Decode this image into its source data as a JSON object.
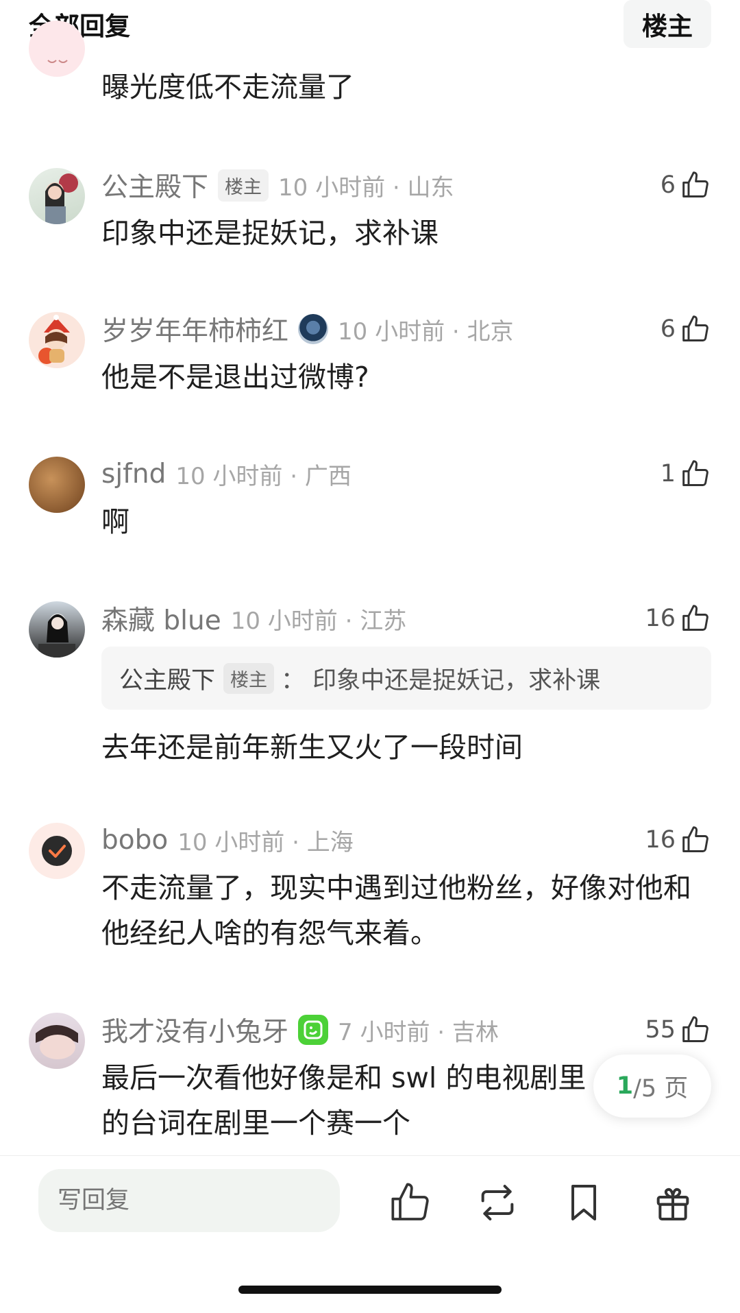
{
  "header": {
    "title": "全部回复",
    "owner_button": "楼主"
  },
  "comments": [
    {
      "author": "",
      "body": "曝光度低不走流量了"
    },
    {
      "author": "公主殿下",
      "tag": "楼主",
      "time": "10 小时前 · 山东",
      "likes": "6",
      "body": "印象中还是捉妖记，求补课"
    },
    {
      "author": "岁岁年年柿柿红",
      "time": "10 小时前 · 北京",
      "likes": "6",
      "body": "他是不是退出过微博?"
    },
    {
      "author": "sjfnd",
      "time": "10 小时前 · 广西",
      "likes": "1",
      "body": "啊"
    },
    {
      "author": "森藏 blue",
      "time": "10 小时前 · 江苏",
      "likes": "16",
      "quote": {
        "author": "公主殿下",
        "tag": "楼主",
        "text": "：  印象中还是捉妖记，求补课"
      },
      "body": "去年还是前年新生又火了一段时间"
    },
    {
      "author": "bobo",
      "time": "10 小时前 · 上海",
      "likes": "16",
      "body": "不走流量了，现实中遇到过他粉丝，好像对他和他经纪人啥的有怨气来着。"
    },
    {
      "author": "我才没有小兔牙",
      "time": "7 小时前 · 吉林",
      "likes": "55",
      "body": "最后一次看他好像是和 swl 的电视剧里的台词在剧里一个赛一个"
    }
  ],
  "pagination": {
    "current": "1",
    "total_text": "/5 页"
  },
  "bottom_bar": {
    "reply_placeholder": "写回复"
  },
  "colors": {
    "accent_green": "#2aa85b",
    "meta_gray": "#a6a6a6",
    "author_gray": "#777777"
  },
  "icons": [
    "thumbs-up-icon",
    "repost-icon",
    "bookmark-icon",
    "gift-icon"
  ]
}
